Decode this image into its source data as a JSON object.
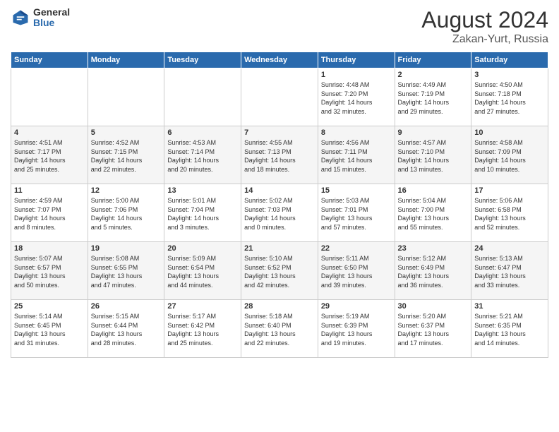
{
  "header": {
    "logo_general": "General",
    "logo_blue": "Blue",
    "main_title": "August 2024",
    "sub_title": "Zakan-Yurt, Russia"
  },
  "weekdays": [
    "Sunday",
    "Monday",
    "Tuesday",
    "Wednesday",
    "Thursday",
    "Friday",
    "Saturday"
  ],
  "weeks": [
    [
      {
        "day": "",
        "info": ""
      },
      {
        "day": "",
        "info": ""
      },
      {
        "day": "",
        "info": ""
      },
      {
        "day": "",
        "info": ""
      },
      {
        "day": "1",
        "info": "Sunrise: 4:48 AM\nSunset: 7:20 PM\nDaylight: 14 hours\nand 32 minutes."
      },
      {
        "day": "2",
        "info": "Sunrise: 4:49 AM\nSunset: 7:19 PM\nDaylight: 14 hours\nand 29 minutes."
      },
      {
        "day": "3",
        "info": "Sunrise: 4:50 AM\nSunset: 7:18 PM\nDaylight: 14 hours\nand 27 minutes."
      }
    ],
    [
      {
        "day": "4",
        "info": "Sunrise: 4:51 AM\nSunset: 7:17 PM\nDaylight: 14 hours\nand 25 minutes."
      },
      {
        "day": "5",
        "info": "Sunrise: 4:52 AM\nSunset: 7:15 PM\nDaylight: 14 hours\nand 22 minutes."
      },
      {
        "day": "6",
        "info": "Sunrise: 4:53 AM\nSunset: 7:14 PM\nDaylight: 14 hours\nand 20 minutes."
      },
      {
        "day": "7",
        "info": "Sunrise: 4:55 AM\nSunset: 7:13 PM\nDaylight: 14 hours\nand 18 minutes."
      },
      {
        "day": "8",
        "info": "Sunrise: 4:56 AM\nSunset: 7:11 PM\nDaylight: 14 hours\nand 15 minutes."
      },
      {
        "day": "9",
        "info": "Sunrise: 4:57 AM\nSunset: 7:10 PM\nDaylight: 14 hours\nand 13 minutes."
      },
      {
        "day": "10",
        "info": "Sunrise: 4:58 AM\nSunset: 7:09 PM\nDaylight: 14 hours\nand 10 minutes."
      }
    ],
    [
      {
        "day": "11",
        "info": "Sunrise: 4:59 AM\nSunset: 7:07 PM\nDaylight: 14 hours\nand 8 minutes."
      },
      {
        "day": "12",
        "info": "Sunrise: 5:00 AM\nSunset: 7:06 PM\nDaylight: 14 hours\nand 5 minutes."
      },
      {
        "day": "13",
        "info": "Sunrise: 5:01 AM\nSunset: 7:04 PM\nDaylight: 14 hours\nand 3 minutes."
      },
      {
        "day": "14",
        "info": "Sunrise: 5:02 AM\nSunset: 7:03 PM\nDaylight: 14 hours\nand 0 minutes."
      },
      {
        "day": "15",
        "info": "Sunrise: 5:03 AM\nSunset: 7:01 PM\nDaylight: 13 hours\nand 57 minutes."
      },
      {
        "day": "16",
        "info": "Sunrise: 5:04 AM\nSunset: 7:00 PM\nDaylight: 13 hours\nand 55 minutes."
      },
      {
        "day": "17",
        "info": "Sunrise: 5:06 AM\nSunset: 6:58 PM\nDaylight: 13 hours\nand 52 minutes."
      }
    ],
    [
      {
        "day": "18",
        "info": "Sunrise: 5:07 AM\nSunset: 6:57 PM\nDaylight: 13 hours\nand 50 minutes."
      },
      {
        "day": "19",
        "info": "Sunrise: 5:08 AM\nSunset: 6:55 PM\nDaylight: 13 hours\nand 47 minutes."
      },
      {
        "day": "20",
        "info": "Sunrise: 5:09 AM\nSunset: 6:54 PM\nDaylight: 13 hours\nand 44 minutes."
      },
      {
        "day": "21",
        "info": "Sunrise: 5:10 AM\nSunset: 6:52 PM\nDaylight: 13 hours\nand 42 minutes."
      },
      {
        "day": "22",
        "info": "Sunrise: 5:11 AM\nSunset: 6:50 PM\nDaylight: 13 hours\nand 39 minutes."
      },
      {
        "day": "23",
        "info": "Sunrise: 5:12 AM\nSunset: 6:49 PM\nDaylight: 13 hours\nand 36 minutes."
      },
      {
        "day": "24",
        "info": "Sunrise: 5:13 AM\nSunset: 6:47 PM\nDaylight: 13 hours\nand 33 minutes."
      }
    ],
    [
      {
        "day": "25",
        "info": "Sunrise: 5:14 AM\nSunset: 6:45 PM\nDaylight: 13 hours\nand 31 minutes."
      },
      {
        "day": "26",
        "info": "Sunrise: 5:15 AM\nSunset: 6:44 PM\nDaylight: 13 hours\nand 28 minutes."
      },
      {
        "day": "27",
        "info": "Sunrise: 5:17 AM\nSunset: 6:42 PM\nDaylight: 13 hours\nand 25 minutes."
      },
      {
        "day": "28",
        "info": "Sunrise: 5:18 AM\nSunset: 6:40 PM\nDaylight: 13 hours\nand 22 minutes."
      },
      {
        "day": "29",
        "info": "Sunrise: 5:19 AM\nSunset: 6:39 PM\nDaylight: 13 hours\nand 19 minutes."
      },
      {
        "day": "30",
        "info": "Sunrise: 5:20 AM\nSunset: 6:37 PM\nDaylight: 13 hours\nand 17 minutes."
      },
      {
        "day": "31",
        "info": "Sunrise: 5:21 AM\nSunset: 6:35 PM\nDaylight: 13 hours\nand 14 minutes."
      }
    ]
  ]
}
